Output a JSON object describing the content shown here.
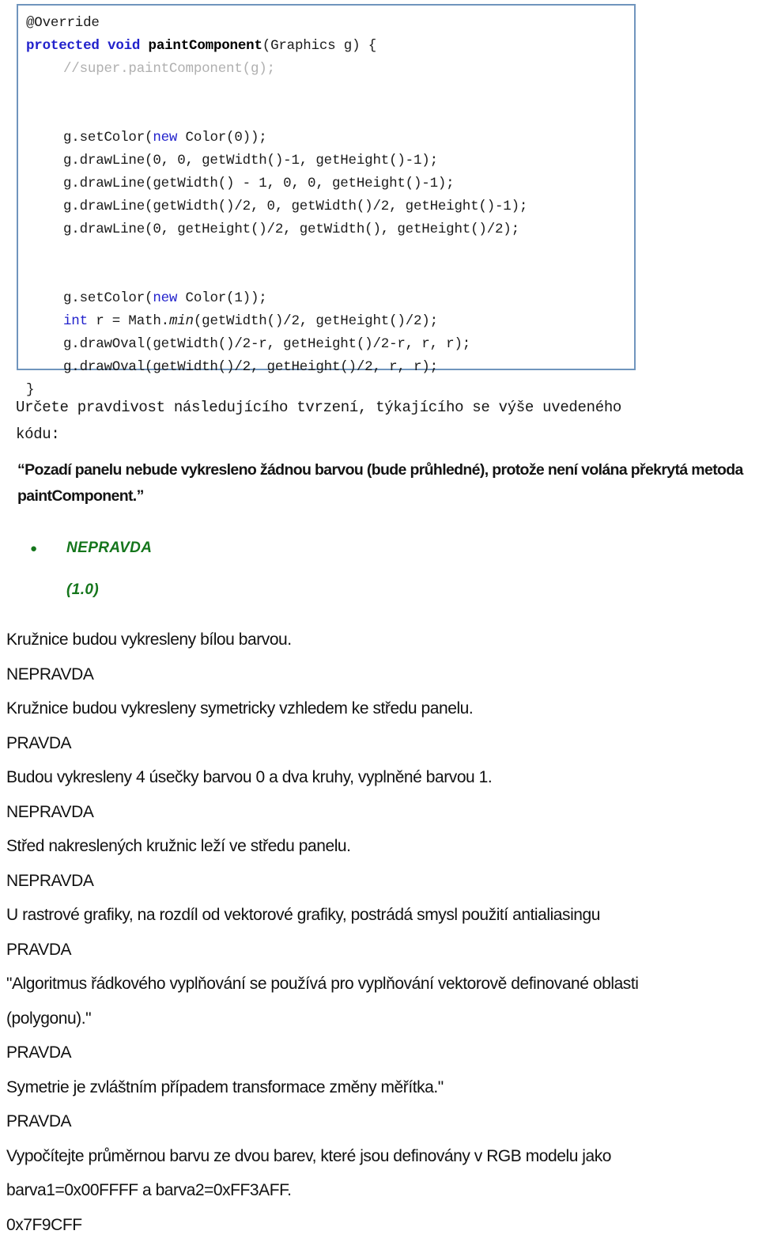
{
  "code_block": {
    "name": "java-paint-component-snippet",
    "lines": [
      {
        "indent": false,
        "segments": [
          {
            "text": "@Override",
            "style": "plain"
          }
        ]
      },
      {
        "indent": false,
        "segments": [
          {
            "text": "protected void ",
            "style": "keyword"
          },
          {
            "text": "paintComponent",
            "style": "bold"
          },
          {
            "text": "(Graphics g) {",
            "style": "plain"
          }
        ]
      },
      {
        "indent": true,
        "segments": [
          {
            "text": "//super.paintComponent(g);",
            "style": "comment"
          }
        ]
      },
      {
        "indent": true,
        "segments": [
          {
            "text": "",
            "style": "plain"
          }
        ]
      },
      {
        "indent": true,
        "segments": [
          {
            "text": "",
            "style": "plain"
          }
        ]
      },
      {
        "indent": true,
        "segments": [
          {
            "text": "g.setColor(",
            "style": "plain"
          },
          {
            "text": "new",
            "style": "keyword-plain"
          },
          {
            "text": " Color(0));",
            "style": "plain"
          }
        ]
      },
      {
        "indent": true,
        "segments": [
          {
            "text": "g.drawLine(0, 0, getWidth()-1, getHeight()-1);",
            "style": "plain"
          }
        ]
      },
      {
        "indent": true,
        "segments": [
          {
            "text": "g.drawLine(getWidth() - 1, 0, 0, getHeight()-1);",
            "style": "plain"
          }
        ]
      },
      {
        "indent": true,
        "segments": [
          {
            "text": "g.drawLine(getWidth()/2, 0, getWidth()/2, getHeight()-1);",
            "style": "plain"
          }
        ]
      },
      {
        "indent": true,
        "segments": [
          {
            "text": "g.drawLine(0, getHeight()/2, getWidth(), getHeight()/2);",
            "style": "plain"
          }
        ]
      },
      {
        "indent": true,
        "segments": [
          {
            "text": "",
            "style": "plain"
          }
        ]
      },
      {
        "indent": true,
        "segments": [
          {
            "text": "",
            "style": "plain"
          }
        ]
      },
      {
        "indent": true,
        "segments": [
          {
            "text": "g.setColor(",
            "style": "plain"
          },
          {
            "text": "new",
            "style": "keyword-plain"
          },
          {
            "text": " Color(1));",
            "style": "plain"
          }
        ]
      },
      {
        "indent": true,
        "segments": [
          {
            "text": "int",
            "style": "keyword-plain"
          },
          {
            "text": " r = Math.",
            "style": "plain"
          },
          {
            "text": "min",
            "style": "italic"
          },
          {
            "text": "(getWidth()/2, getHeight()/2);",
            "style": "plain"
          }
        ]
      },
      {
        "indent": true,
        "segments": [
          {
            "text": "g.drawOval(getWidth()/2-r, getHeight()/2-r, r, r);",
            "style": "plain"
          }
        ]
      },
      {
        "indent": true,
        "segments": [
          {
            "text": "g.drawOval(getWidth()/2, getHeight()/2, r, r);",
            "style": "plain"
          }
        ]
      },
      {
        "indent": false,
        "segments": [
          {
            "text": "}",
            "style": "plain"
          }
        ]
      }
    ]
  },
  "prompt": {
    "text": "Určete pravdivost následujícího tvrzení, týkajícího se výše uvedeného\nkódu:"
  },
  "statement": {
    "text": "“Pozadí panelu nebude vykresleno žádnou barvou (bude průhledné), protože není volána překrytá metoda paintComponent.”"
  },
  "answer": {
    "bullet_glyph": "●",
    "value": "NEPRAVDA",
    "score": "(1.0)",
    "color": "#15761c"
  },
  "qa_lines": [
    "Kružnice budou vykresleny bílou barvou.",
    "NEPRAVDA",
    "Kružnice budou vykresleny symetricky vzhledem ke středu panelu.",
    "PRAVDA",
    "Budou vykresleny 4 úsečky barvou 0 a dva kruhy, vyplněné barvou 1.",
    "NEPRAVDA",
    "Střed nakreslených kružnic leží ve středu panelu.",
    "NEPRAVDA",
    "U rastrové grafiky, na rozdíl od vektorové grafiky, postrádá smysl použití antialiasingu",
    "PRAVDA",
    "\"Algoritmus řádkového vyplňování se používá pro vyplňování vektorově definované oblasti",
    "(polygonu).\"",
    "PRAVDA",
    "Symetrie je zvláštním případem transformace změny měřítka.\"",
    "PRAVDA",
    "Vypočítejte průměrnou barvu ze dvou barev, které jsou definovány v RGB modelu jako",
    "barva1=0x00FFFF a barva2=0xFF3AFF.",
    "0x7F9CFF"
  ]
}
